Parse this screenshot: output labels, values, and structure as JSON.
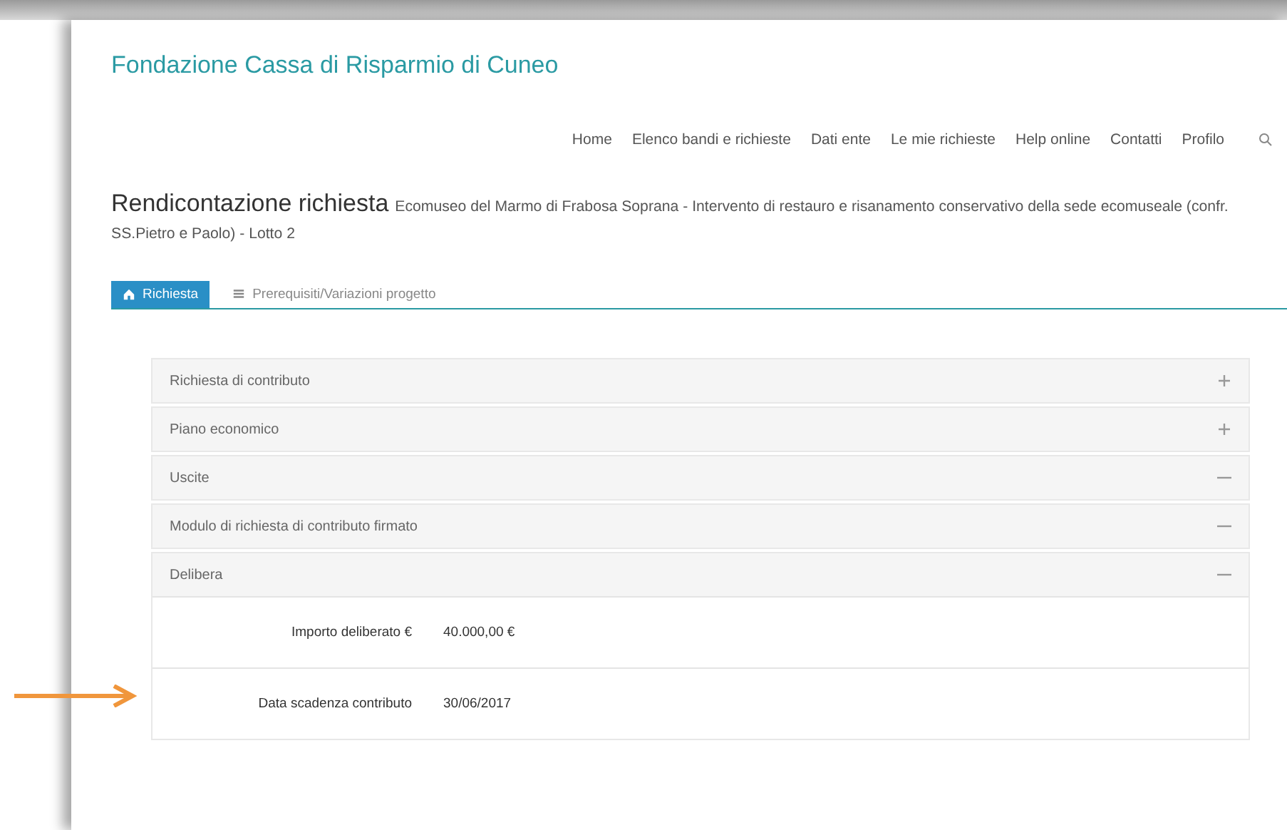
{
  "site_title": "Fondazione Cassa di Risparmio di Cuneo",
  "nav": [
    "Home",
    "Elenco bandi e richieste",
    "Dati ente",
    "Le mie richieste",
    "Help online",
    "Contatti",
    "Profilo"
  ],
  "heading": {
    "title": "Rendicontazione richiesta",
    "subtitle": "Ecomuseo del Marmo di Frabosa Soprana - Intervento di restauro e risanamento conservativo della sede ecomuseale (confr. SS.Pietro e Paolo) - Lotto 2"
  },
  "tabs": [
    {
      "label": "Richiesta",
      "selected": true
    },
    {
      "label": "Prerequisiti/Variazioni progetto",
      "selected": false
    }
  ],
  "panels": [
    {
      "title": "Richiesta di contributo",
      "expanded": false
    },
    {
      "title": "Piano economico",
      "expanded": false
    },
    {
      "title": "Uscite",
      "expanded": true
    },
    {
      "title": "Modulo di richiesta di contributo firmato",
      "expanded": true
    },
    {
      "title": "Delibera",
      "expanded": true,
      "fields": [
        {
          "label": "Importo deliberato €",
          "value": "40.000,00 €"
        },
        {
          "label": "Data scadenza contributo",
          "value": "30/06/2017"
        }
      ]
    }
  ]
}
